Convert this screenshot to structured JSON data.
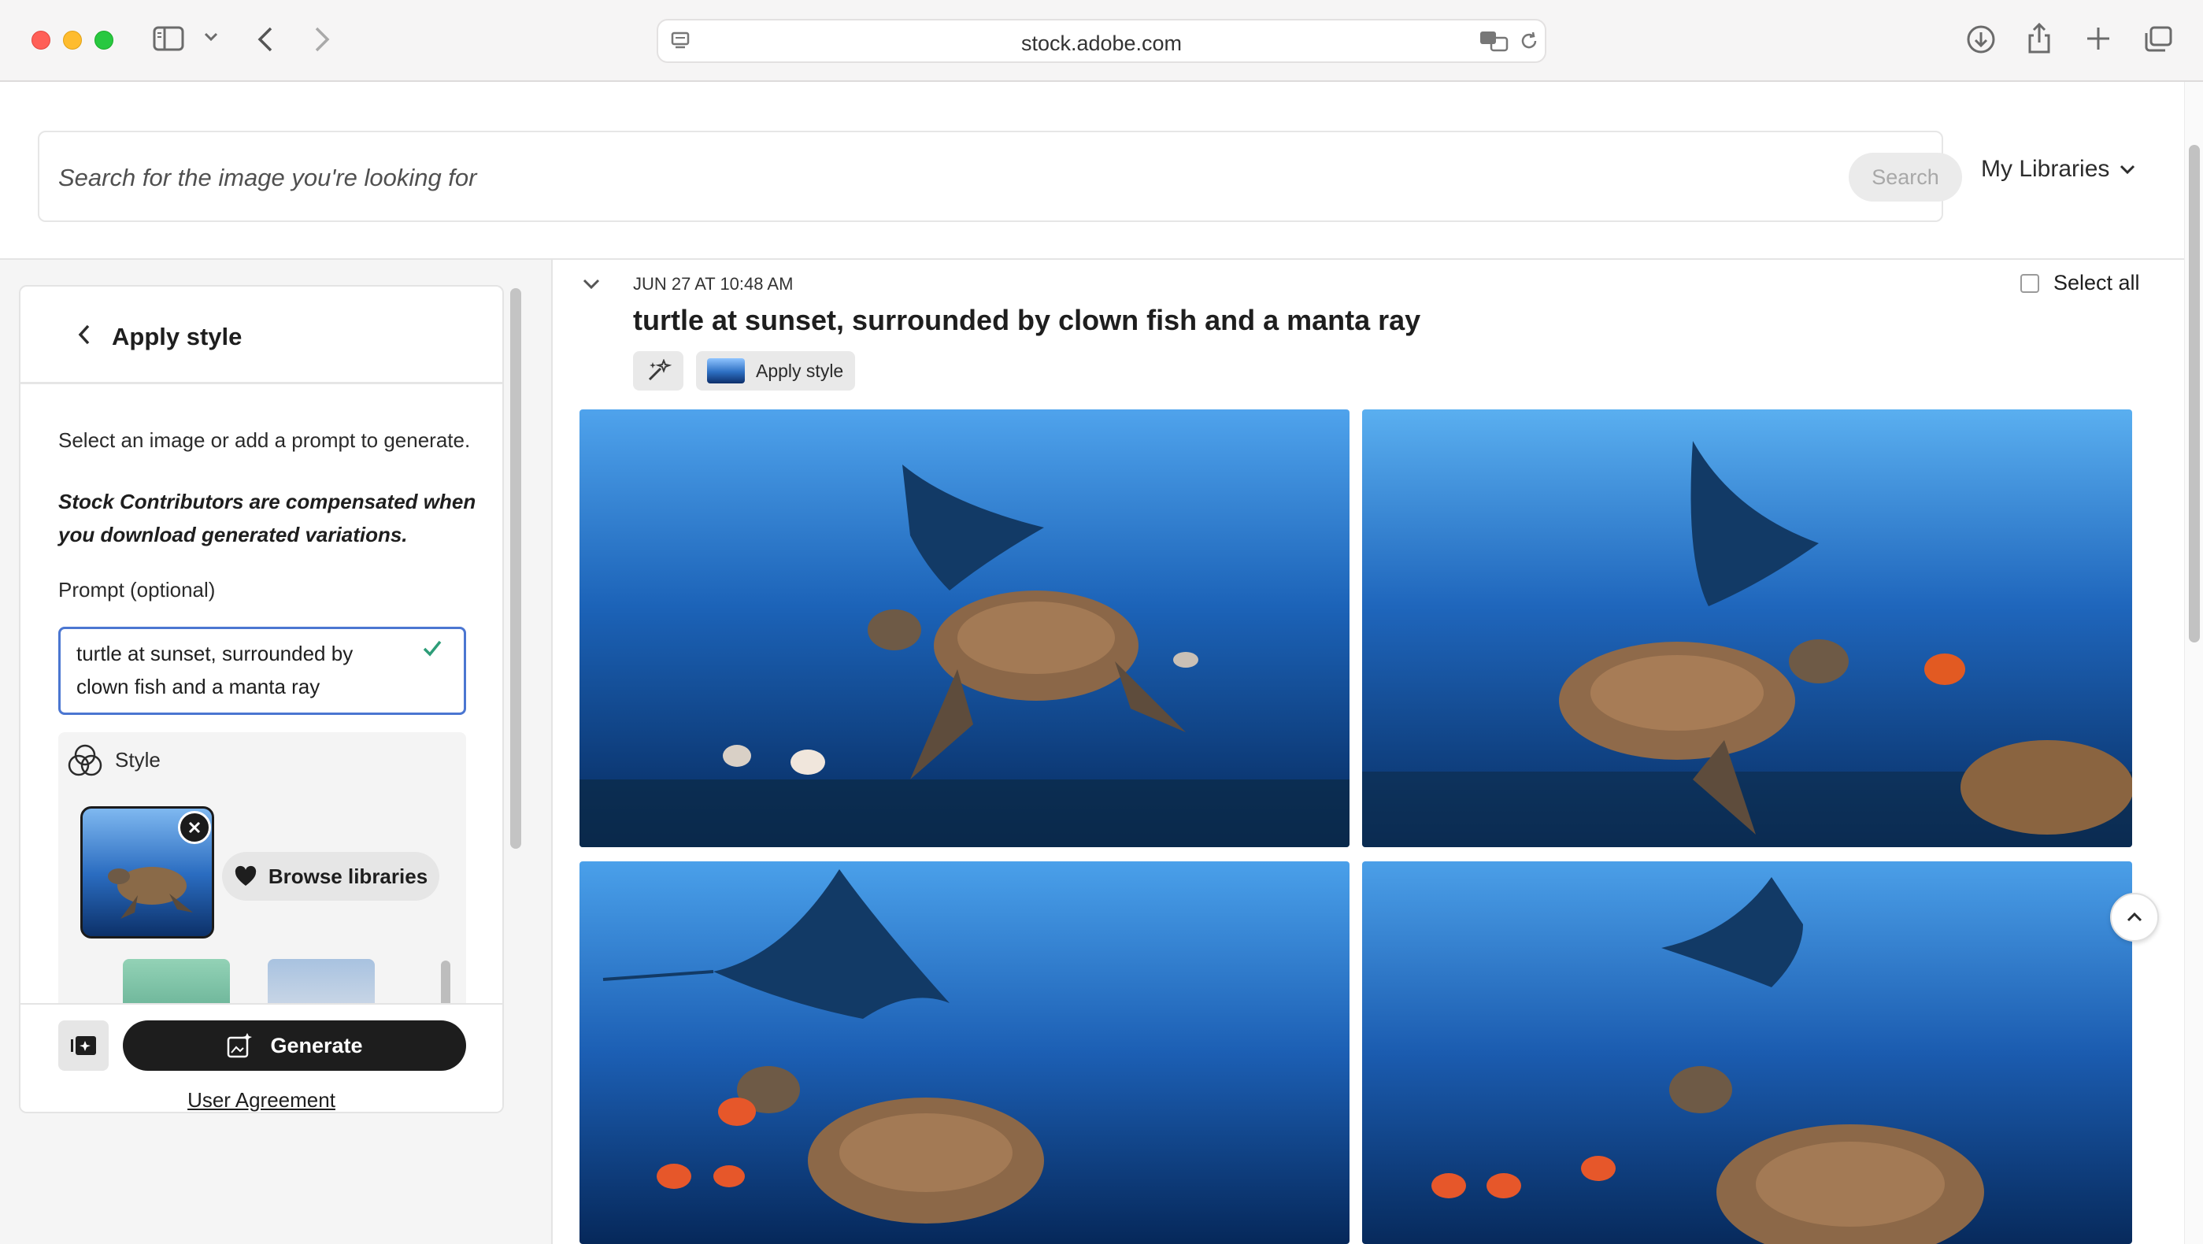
{
  "browser": {
    "url": "stock.adobe.com"
  },
  "search": {
    "placeholder": "Search for the image you're looking for",
    "button_label": "Search",
    "libraries_label": "My Libraries"
  },
  "panel": {
    "title": "Apply style",
    "instruction": "Select an image or add a prompt to generate.",
    "note": "Stock Contributors are compensated when you download generated variations.",
    "prompt_label": "Prompt (optional)",
    "prompt_value": "turtle at sunset, surrounded by clown fish and a manta ray",
    "style_label": "Style",
    "browse_label": "Browse libraries",
    "generate_label": "Generate",
    "user_agreement": "User Agreement"
  },
  "results": {
    "timestamp": "JUN 27 AT 10:48 AM",
    "title": "turtle at sunset, surrounded by clown fish and a manta ray",
    "apply_style_chip": "Apply style",
    "select_all": "Select all"
  },
  "colors": {
    "accent_blue": "#4b76d1",
    "button_dark": "#1d1d1d",
    "ocean_light": "#3a8fe0",
    "ocean_dark": "#072a5c"
  }
}
